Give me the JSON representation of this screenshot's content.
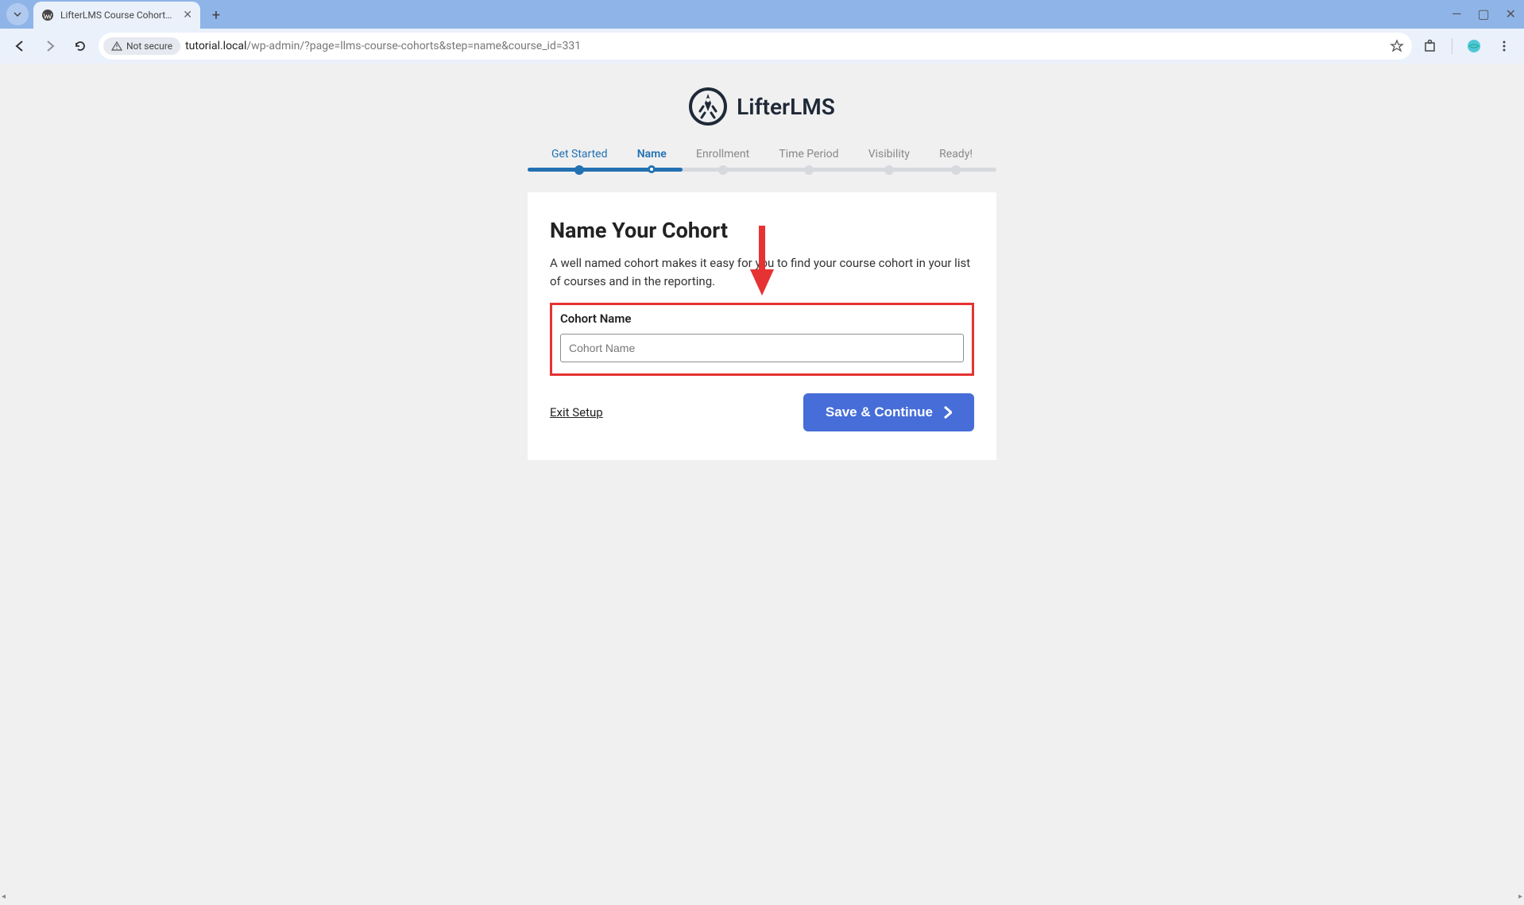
{
  "browser": {
    "tab_title": "LifterLMS Course Cohorts ‹ tuto",
    "security_label": "Not secure",
    "url_host": "tutorial.local",
    "url_path": "/wp-admin/?page=llms-course-cohorts&step=name&course_id=331"
  },
  "logo": {
    "text": "LifterLMS"
  },
  "stepper": {
    "progress_percent": 33,
    "steps": [
      {
        "label": "Get Started",
        "state": "done"
      },
      {
        "label": "Name",
        "state": "active"
      },
      {
        "label": "Enrollment",
        "state": "pending"
      },
      {
        "label": "Time Period",
        "state": "pending"
      },
      {
        "label": "Visibility",
        "state": "pending"
      },
      {
        "label": "Ready!",
        "state": "pending"
      }
    ]
  },
  "card": {
    "title": "Name Your Cohort",
    "description": "A well named cohort makes it easy for you to find your course cohort in your list of courses and in the reporting.",
    "field_label": "Cohort Name",
    "field_placeholder": "Cohort Name",
    "exit_label": "Exit Setup",
    "submit_label": "Save & Continue"
  },
  "annotation": {
    "arrow_color": "#e63232"
  }
}
